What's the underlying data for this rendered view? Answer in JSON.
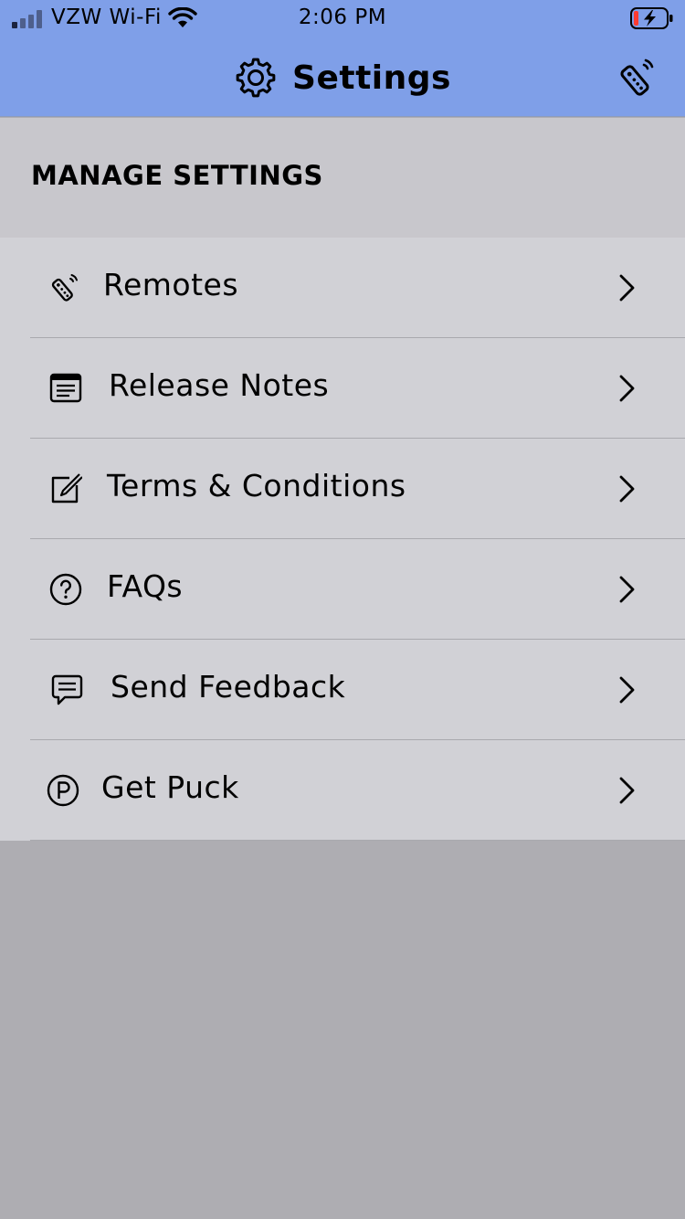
{
  "status_bar": {
    "carrier": "VZW Wi-Fi",
    "time": "2:06 PM",
    "battery_fill_color": "#ff3b30",
    "signal_bars_active": 1,
    "signal_bars_total": 4
  },
  "header": {
    "title": "Settings",
    "title_icon": "gear-icon",
    "action_icon": "remote-icon",
    "background_color": "#7f9fe8"
  },
  "section": {
    "title": "MANAGE SETTINGS"
  },
  "menu": {
    "items": [
      {
        "label": "Remotes",
        "icon": "remote-icon"
      },
      {
        "label": "Release Notes",
        "icon": "notes-icon"
      },
      {
        "label": "Terms & Conditions",
        "icon": "edit-icon"
      },
      {
        "label": "FAQs",
        "icon": "question-circle-icon"
      },
      {
        "label": "Send Feedback",
        "icon": "chat-bubble-icon"
      },
      {
        "label": "Get Puck",
        "icon": "puck-p-icon"
      }
    ]
  }
}
